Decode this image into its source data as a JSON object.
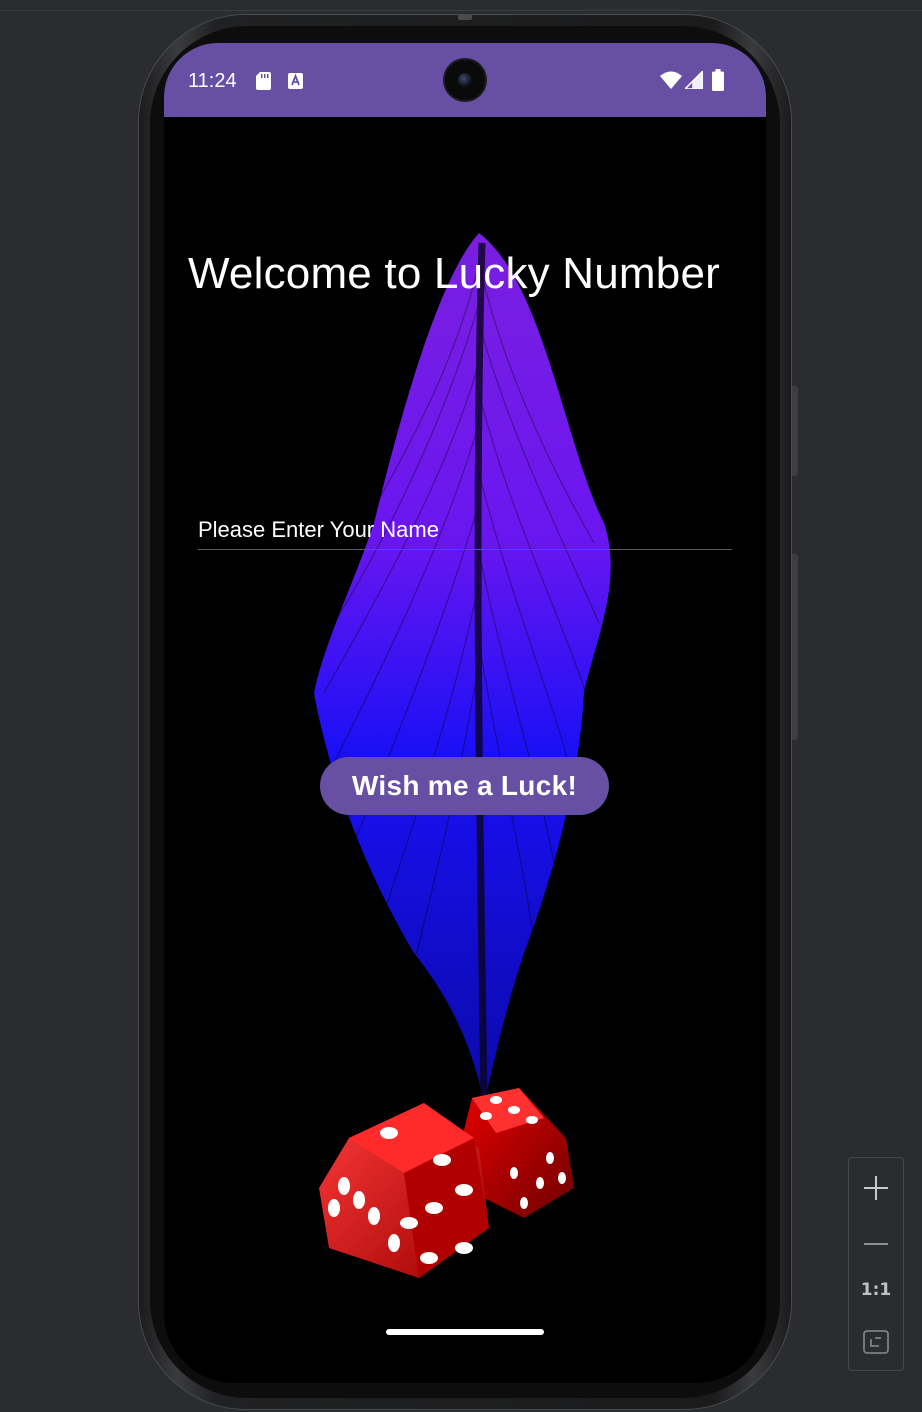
{
  "status_bar": {
    "time": "11:24",
    "color": "#6750a4"
  },
  "app": {
    "title": "Welcome to Lucky Number",
    "name_input": {
      "value": "",
      "placeholder": "Please Enter Your Name"
    },
    "wish_button": {
      "label": "Wish me a Luck!",
      "color": "#6750a4"
    }
  },
  "emulator_controls": {
    "zoom_in_icon": "plus-icon",
    "zoom_out_icon": "minus-icon",
    "actual_size_label": "1:1",
    "fit_screen_icon": "fit-screen-icon"
  }
}
